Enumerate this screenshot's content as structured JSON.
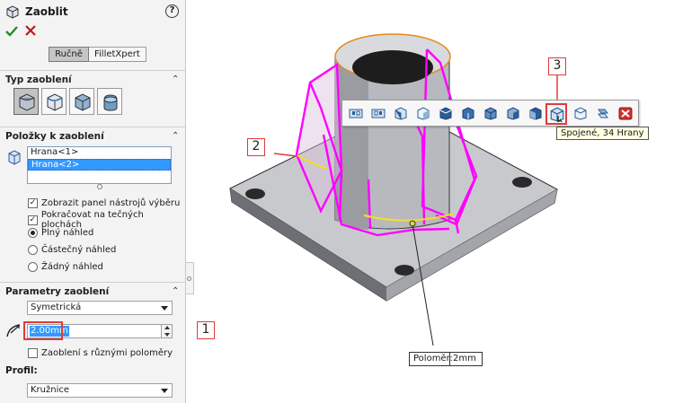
{
  "panel": {
    "title": "Zaoblit",
    "help_icon": "?",
    "tabs": [
      "Ručně",
      "FilletXpert"
    ],
    "sections": {
      "fillet_type": "Typ zaoblení",
      "items_to_fillet": "Položky k zaoblení",
      "fillet_params": "Parametry zaoblení",
      "profile": "Profil:"
    },
    "fillet_type_icons": [
      "constant-size-fillet-icon",
      "variable-size-fillet-icon",
      "face-fillet-icon",
      "full-round-fillet-icon"
    ],
    "edges": [
      "Hrana<1>",
      "Hrana<2>"
    ],
    "selected_edge": "Hrana<2>",
    "checkboxes": [
      {
        "label": "Zobrazit panel nástrojů výběru",
        "checked": true
      },
      {
        "label": "Pokračovat na tečných plochách",
        "checked": true
      }
    ],
    "preview_options": [
      {
        "label": "Plný náhled",
        "selected": true
      },
      {
        "label": "Částečný náhled",
        "selected": false
      },
      {
        "label": "Žádný náhled",
        "selected": false
      }
    ],
    "method": "Symetrická",
    "radius": "2.00mm",
    "multi_radius": {
      "label": "Zaoblení s různými poloměry",
      "checked": false
    },
    "profile_value": "Kružnice"
  },
  "viewport": {
    "callouts": [
      "1",
      "2",
      "3"
    ],
    "toolbar_icons": [
      "connected-to-start-loop-icon",
      "connected-to-end-loop-icon",
      "connected-to-start-face-icon",
      "connected-to-start-face-2-icon",
      "side-face-icon",
      "feature-icon",
      "connected-to-end-face-icon",
      "convex-edges-icon",
      "concave-edges-icon",
      "connected-edges-icon",
      "tangent-edges-icon",
      "loop-edges-icon",
      "close-icon"
    ],
    "tooltip": "Spojené, 34 Hrany",
    "leader_label": "Poloměr:",
    "leader_value": "2mm"
  },
  "colors": {
    "selection": "#ff00ff",
    "highlight_edge": "#f0dc30",
    "callout_red": "#e03a3a",
    "list_selection": "#3399ff"
  }
}
